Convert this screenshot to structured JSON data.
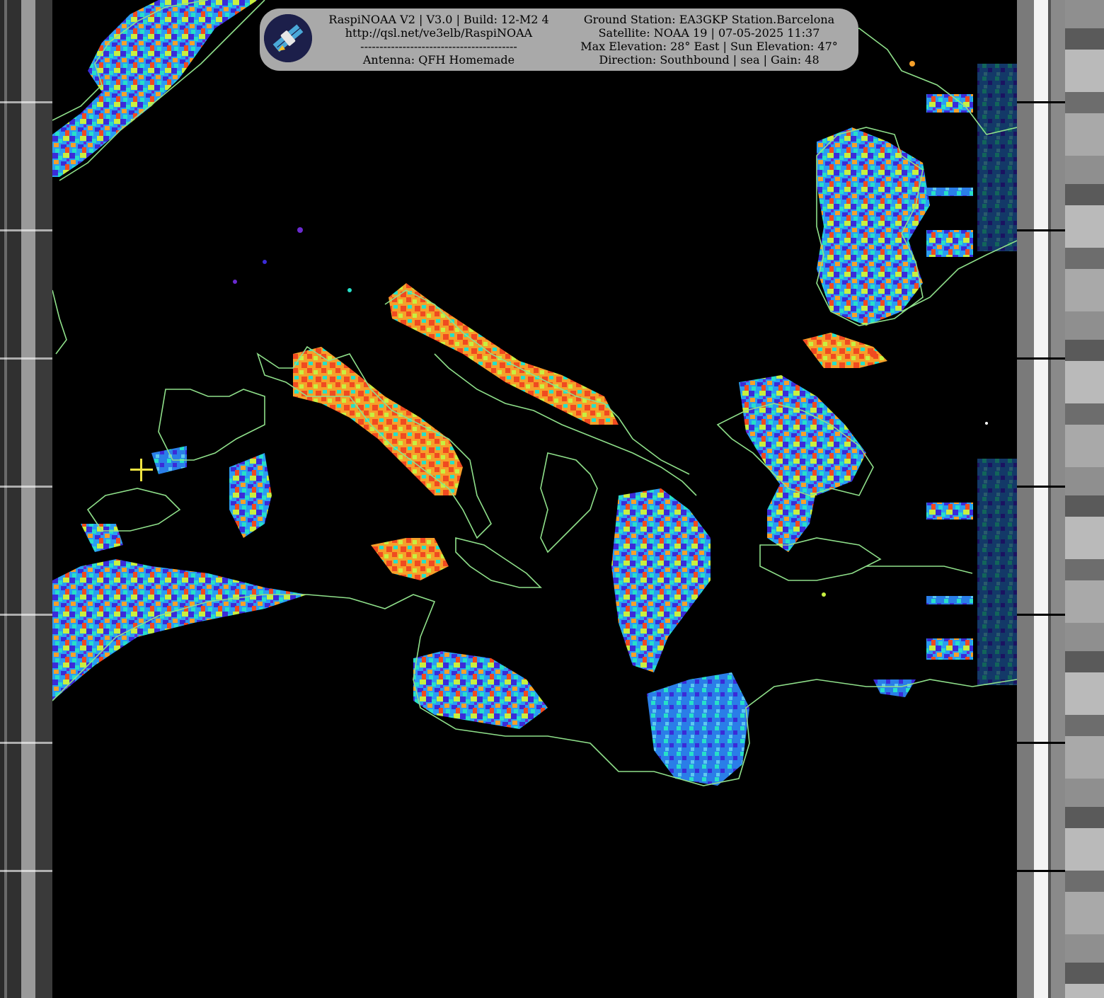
{
  "banner": {
    "software": "RaspiNOAA V2 | V3.0 | Build: 12-M2 4",
    "url": "http://qsl.net/ve3elb/RaspiNOAA",
    "divider": "-----------------------------------------",
    "antenna": "Antenna: QFH Homemade",
    "ground_station": "Ground Station: EA3GKP Station.Barcelona",
    "satellite": "Satellite: NOAA 19 | 07-05-2025 11:37",
    "elevation": "Max Elevation: 28° East | Sun Elevation: 47°",
    "direction": "Direction: Southbound | sea | Gain: 48"
  },
  "colors": {
    "banner_bg": "#a9a9a9",
    "coastline": "#8fe08a",
    "marker": "#f0e442",
    "palette": [
      "#3b2bd8",
      "#2a9df4",
      "#27e0c8",
      "#c8f040",
      "#f6a02a",
      "#f04a20"
    ]
  },
  "icons": {
    "logo": "satellite-icon",
    "marker": "crosshair-icon"
  }
}
